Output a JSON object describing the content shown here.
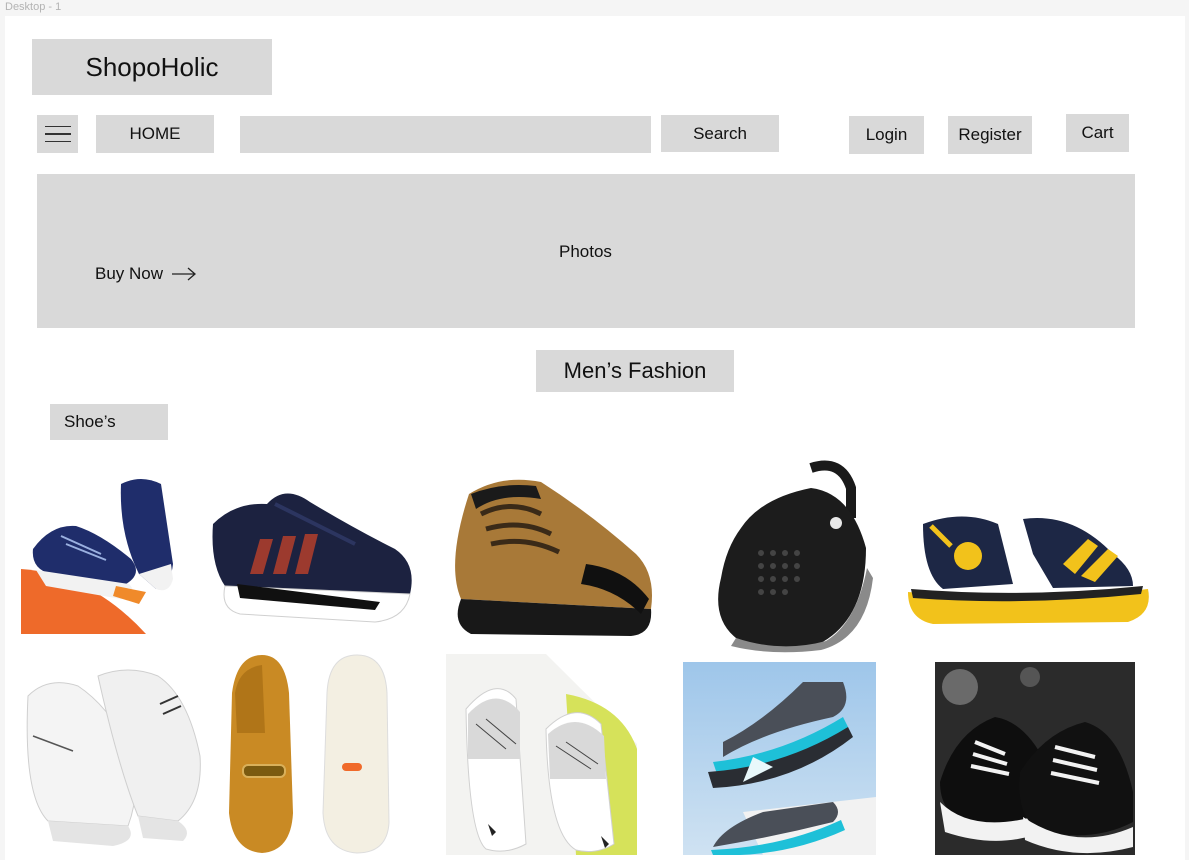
{
  "canvas": {
    "frame_label": "Desktop - 1"
  },
  "header": {
    "logo": "ShopoHolic"
  },
  "nav": {
    "home_label": "HOME",
    "search_value": "",
    "search_label": "Search",
    "login_label": "Login",
    "register_label": "Register",
    "cart_label": "Cart"
  },
  "banner": {
    "placeholder": "Photos",
    "cta_label": "Buy Now"
  },
  "section": {
    "title": "Men’s Fashion",
    "category": "Shoe’s"
  },
  "products": [
    {
      "name": "Blue running shoes pair"
    },
    {
      "name": "Navy sports sneaker"
    },
    {
      "name": "Brown trekking boot"
    },
    {
      "name": "Black clog"
    },
    {
      "name": "Navy and yellow sandal"
    },
    {
      "name": "White sneakers pair"
    },
    {
      "name": "Tan loafer"
    },
    {
      "name": "White printed slides"
    },
    {
      "name": "Grey and teal sandals"
    },
    {
      "name": "Black canvas sneakers"
    }
  ]
}
